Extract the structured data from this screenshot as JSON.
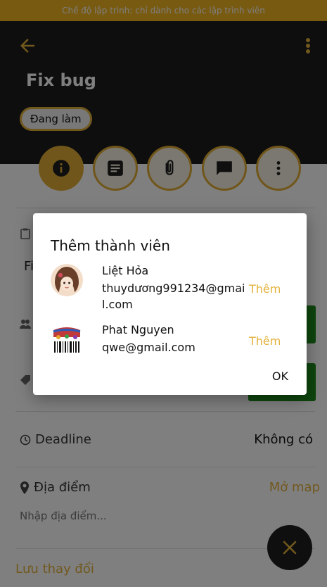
{
  "banner": {
    "text": "Chế độ lập trình: chỉ dành cho các lập trình viên"
  },
  "header": {
    "title": "Fix bug",
    "status": "Đang làm"
  },
  "tabs": [
    {
      "icon": "info-icon"
    },
    {
      "icon": "notes-icon"
    },
    {
      "icon": "attachment-icon"
    },
    {
      "icon": "chat-icon"
    },
    {
      "icon": "more-vert-icon"
    }
  ],
  "fields": {
    "partial_text": "Fi",
    "deadline_label": "Deadline",
    "deadline_value": "Không có",
    "location_label": "Địa điểm",
    "open_map": "Mở map",
    "location_placeholder": "Nhập địa điểm..."
  },
  "footer": {
    "save": "Lưu thay đổi"
  },
  "dialog": {
    "title": "Thêm thành viên",
    "members": [
      {
        "name": "Liệt Hỏa",
        "email": "thuydương991234@gmail.com",
        "action": "Thêm"
      },
      {
        "name": "Phat Nguyen",
        "email": "qwe@gmail.com",
        "action": "Thêm"
      }
    ],
    "ok": "OK"
  },
  "colors": {
    "accent": "#e3b13a",
    "header_bg": "#1c1c1c",
    "banner_bg": "#f0b423",
    "green": "#1d8a1d"
  }
}
